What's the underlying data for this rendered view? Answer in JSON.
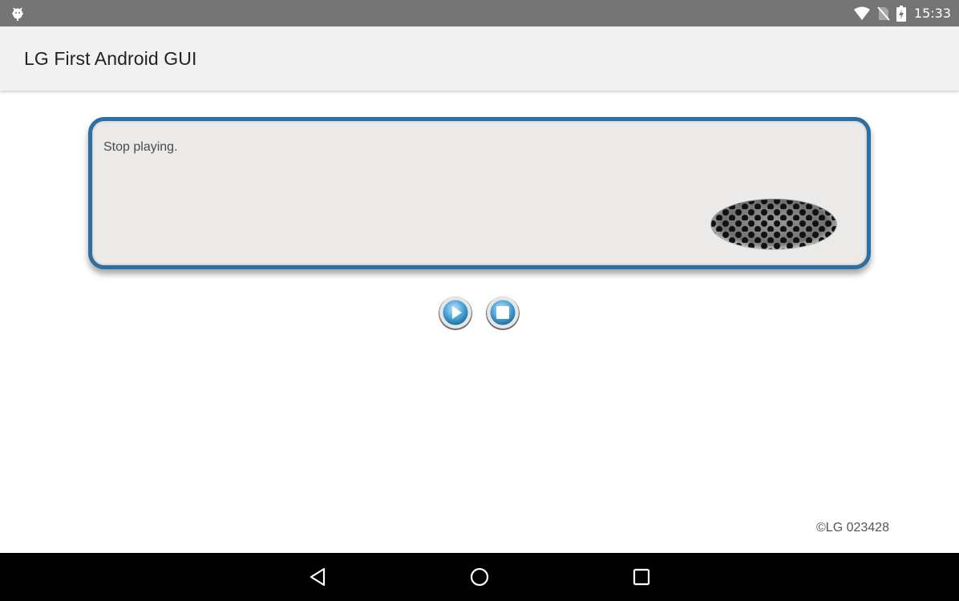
{
  "status_bar": {
    "time": "15:33",
    "left_icon": "android-debug-icon",
    "right_icons": [
      "wifi-icon",
      "no-sim-icon",
      "battery-charging-icon"
    ]
  },
  "app_bar": {
    "title": "LG First Android GUI"
  },
  "message_panel": {
    "text": "Stop playing.",
    "decoration": "speaker-grille-icon"
  },
  "controls": {
    "buttons": [
      "play-icon",
      "stop-icon"
    ]
  },
  "footer": {
    "copyright": "©LG 023428"
  },
  "nav_bar": {
    "buttons": [
      "back-icon",
      "home-icon",
      "recents-icon"
    ]
  },
  "colors": {
    "status_bar": "#757575",
    "app_bar": "#f1f1f1",
    "panel_border": "#2d6fa3",
    "panel_fill": "#ebeae8",
    "button_blue": "#4aa3d8",
    "nav_bar": "#000000"
  }
}
